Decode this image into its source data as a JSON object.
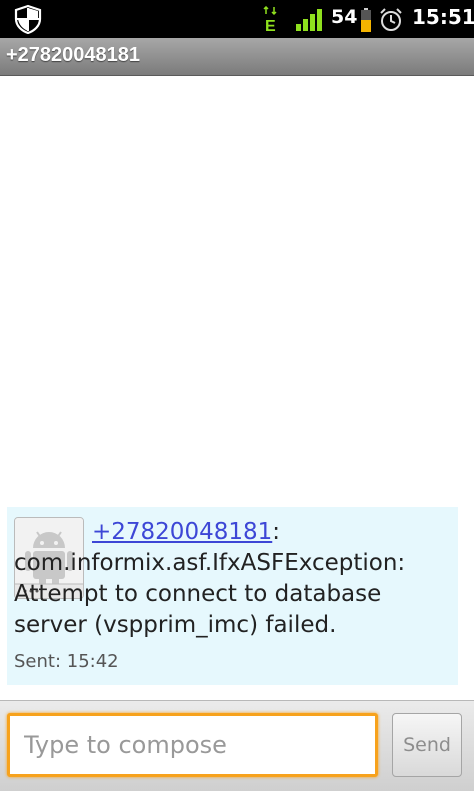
{
  "status_bar": {
    "battery_level": "54",
    "time": "15:51",
    "icons": [
      "shield-icon",
      "edge-data-icon",
      "signal-strength-icon",
      "battery-icon",
      "alarm-icon"
    ],
    "colors": {
      "signal": "#8fe01e",
      "battery": "#f4b400"
    }
  },
  "header": {
    "title": "+27820048181"
  },
  "conversation": {
    "messages": [
      {
        "sender": "+27820048181",
        "body": ": com.informix.asf.IfxASFException: Attempt to connect to database server (vspprim_imc) failed.",
        "sent_label": "Sent: 15:42"
      }
    ]
  },
  "composer": {
    "placeholder": "Type to compose",
    "value": "",
    "send_label": "Send"
  },
  "colors": {
    "accent_focus": "#f7a21c",
    "message_bubble": "#e6f8fd",
    "link": "#3d47d6"
  }
}
